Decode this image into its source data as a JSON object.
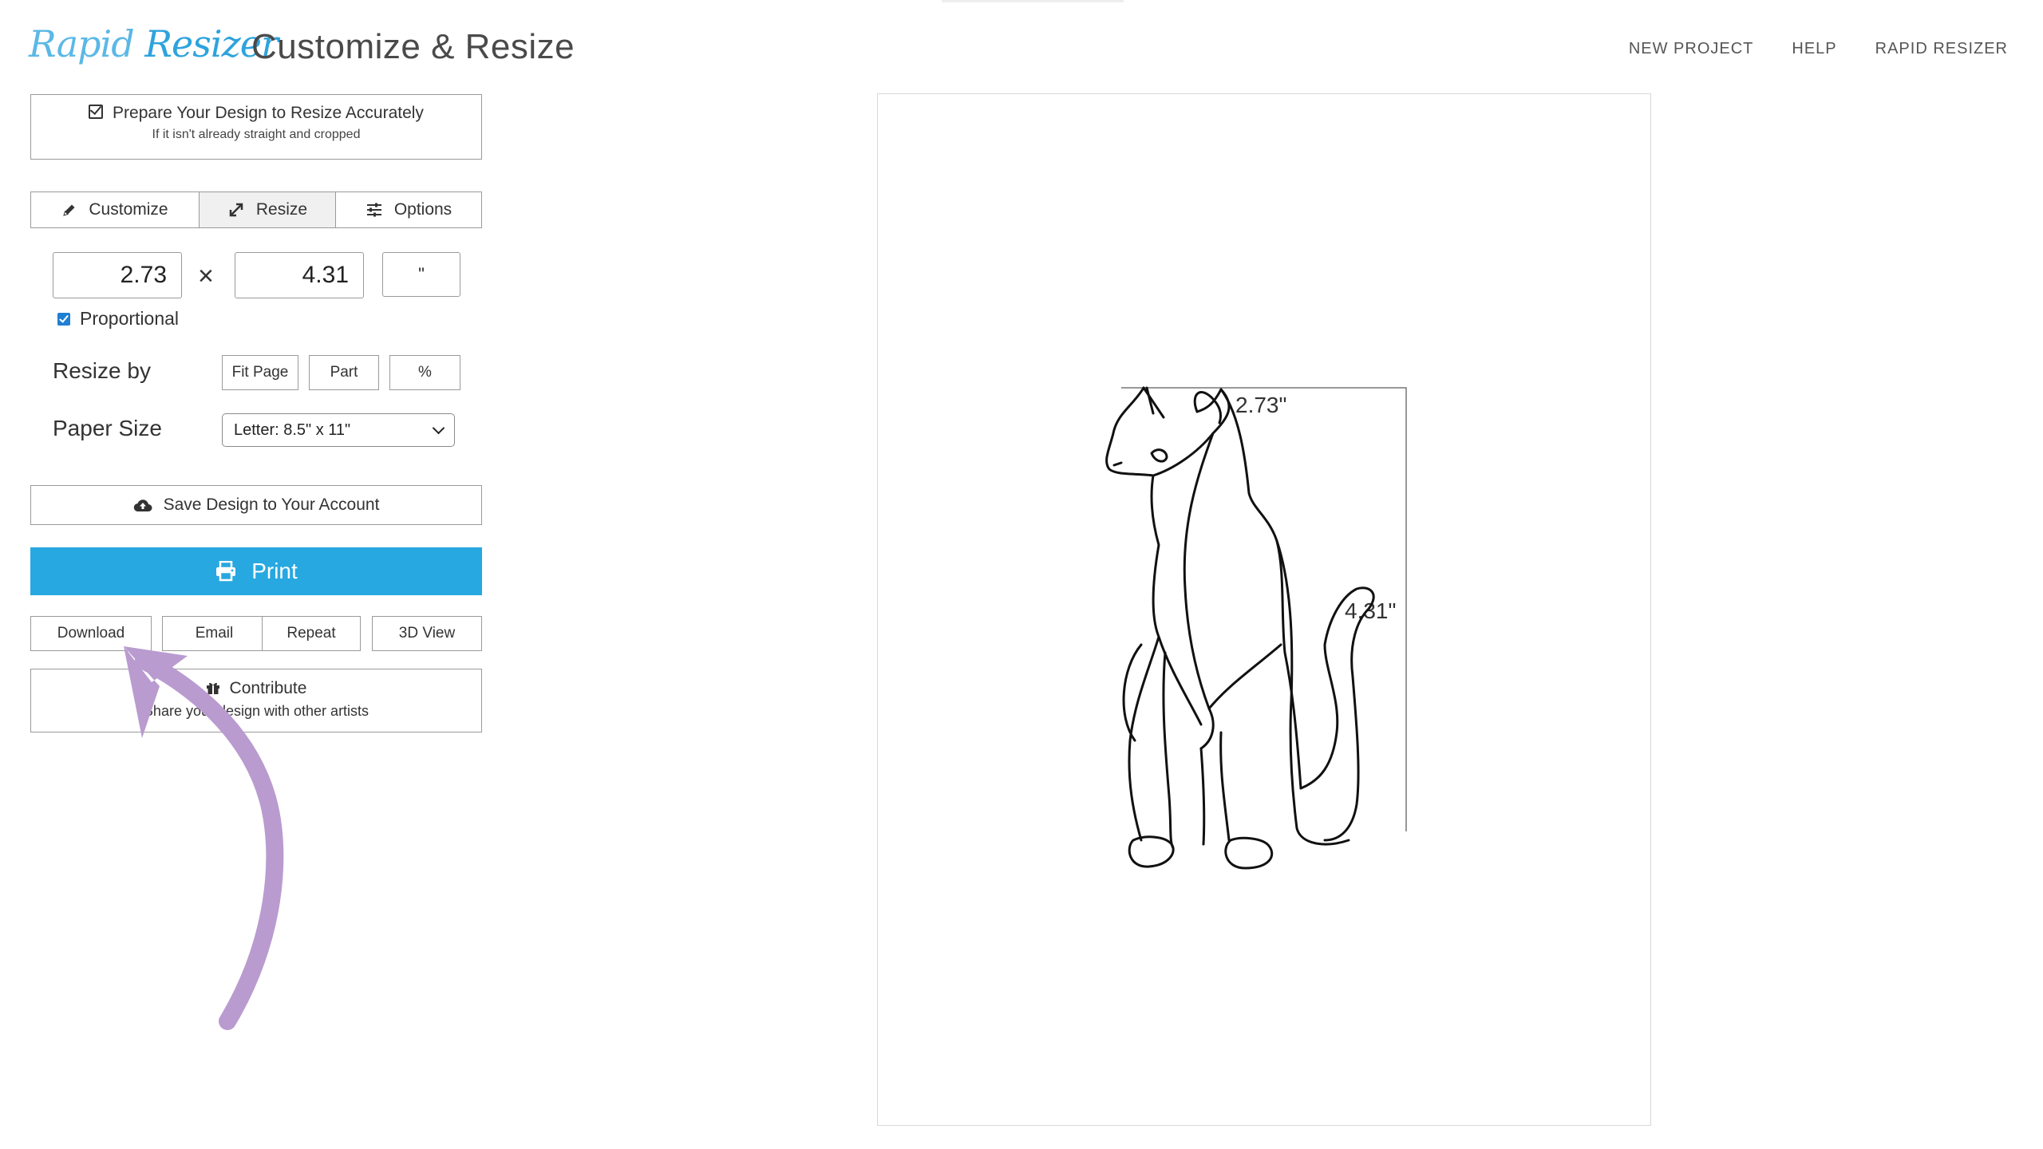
{
  "header": {
    "logo_part1": "Rapid",
    "logo_part2": "Resizer",
    "title": "Customize & Resize",
    "nav": [
      "NEW PROJECT",
      "HELP",
      "RAPID RESIZER"
    ]
  },
  "prepare": {
    "title": "Prepare Your Design to Resize Accurately",
    "subtitle": "If it isn't already straight and cropped"
  },
  "tabs": [
    {
      "label": "Customize",
      "icon": "pencil-icon"
    },
    {
      "label": "Resize",
      "icon": "expand-arrows-icon",
      "active": true
    },
    {
      "label": "Options",
      "icon": "sliders-icon"
    }
  ],
  "resize": {
    "width": "2.73",
    "height": "4.31",
    "times": "×",
    "unit": "\"",
    "proportional_label": "Proportional",
    "proportional_checked": true,
    "resize_by_label": "Resize by",
    "resize_by_options": [
      "Fit Page",
      "Part",
      "%"
    ],
    "paper_size_label": "Paper Size",
    "paper_size_value": "Letter: 8.5\" x 11\""
  },
  "actions": {
    "save_label": "Save Design to Your Account",
    "print_label": "Print",
    "buttons": [
      "Download",
      "Email",
      "Repeat",
      "3D View"
    ],
    "contribute_title": "Contribute",
    "contribute_subtitle": "Share your design with other artists"
  },
  "canvas": {
    "width_label": "2.73\"",
    "height_label": "4.31\""
  },
  "colors": {
    "print_button": "#27a8e0",
    "logo": "#5bb8e6",
    "annotation_arrow": "#b99bd0",
    "checkbox": "#1f7fd2"
  }
}
